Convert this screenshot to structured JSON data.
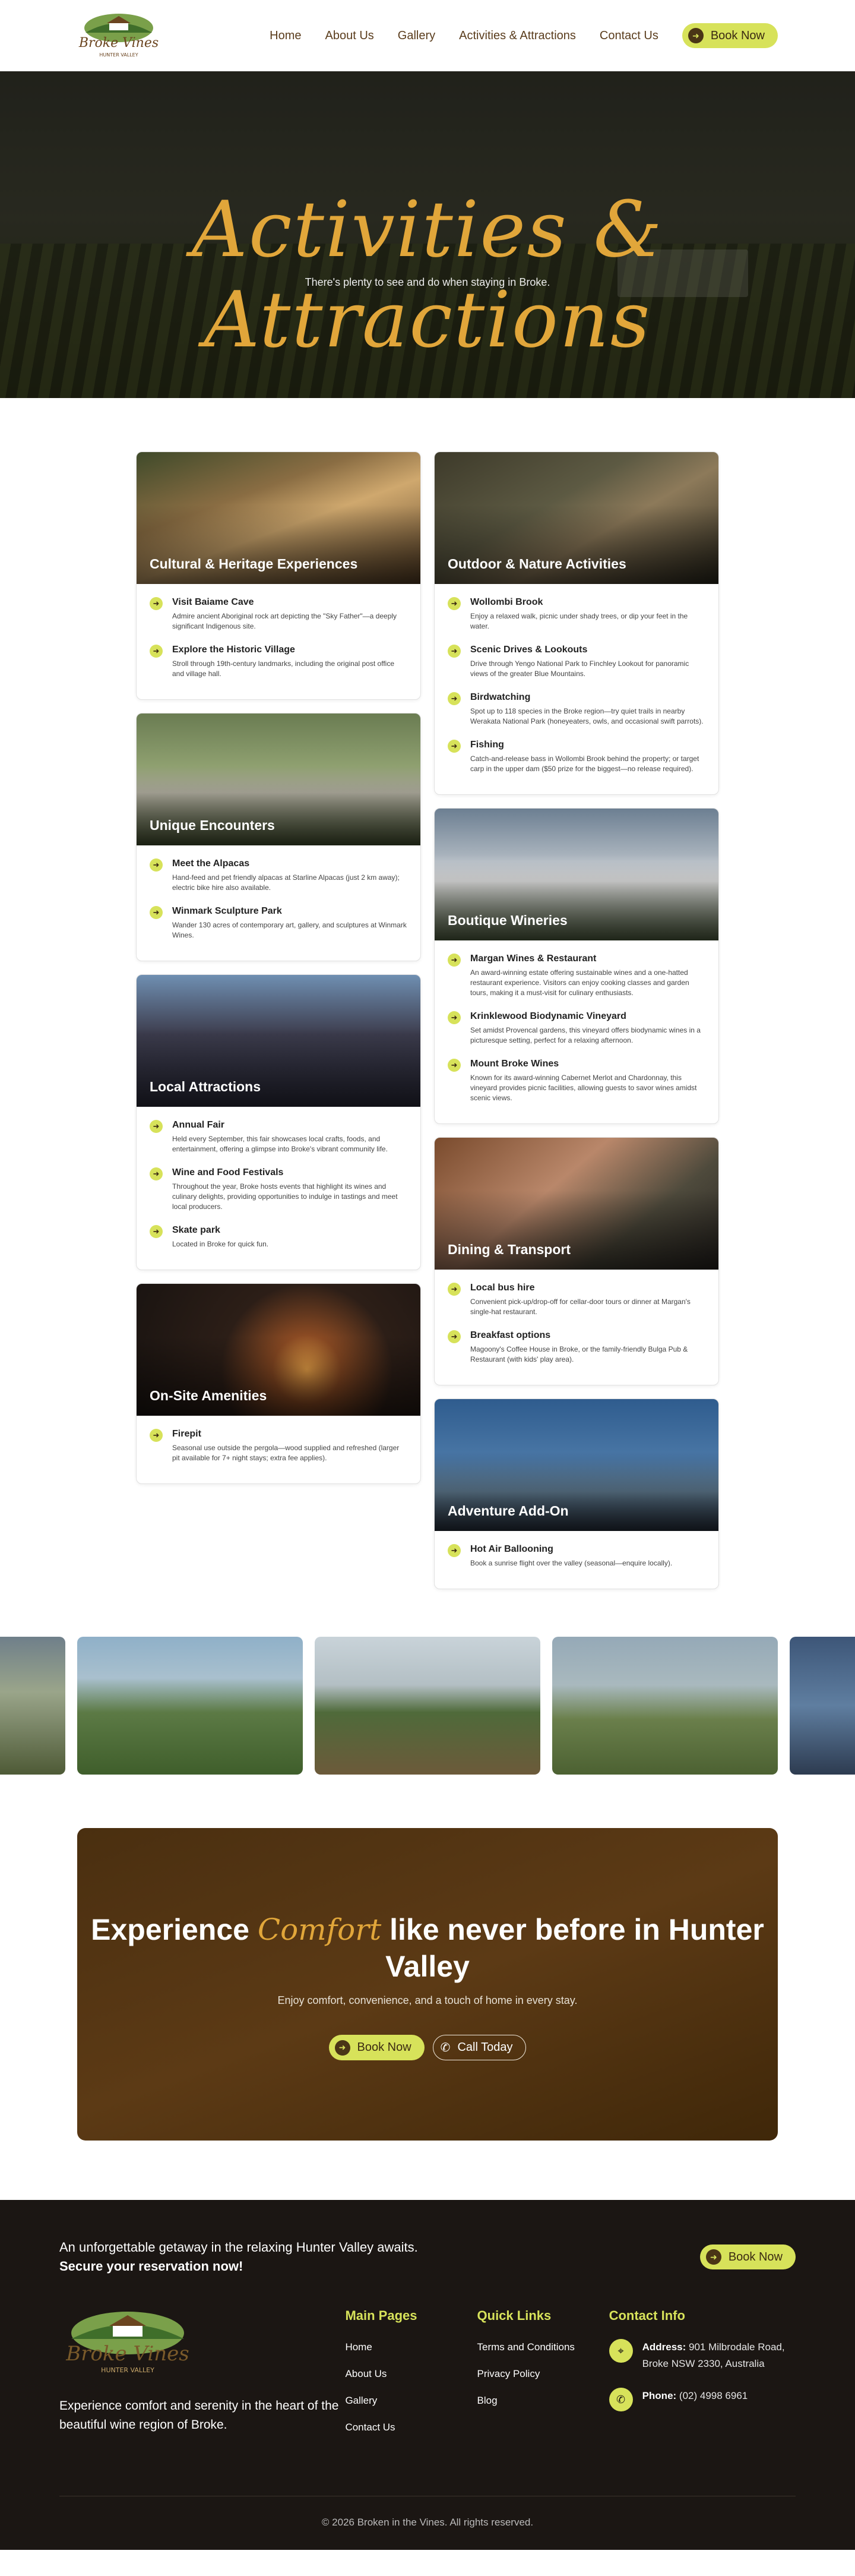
{
  "nav": {
    "logo_text": "Broke Vines",
    "logo_sub": "HUNTER VALLEY",
    "links": [
      "Home",
      "About Us",
      "Gallery",
      "Activities & Attractions",
      "Contact Us"
    ],
    "book_label": "Book Now"
  },
  "hero": {
    "title": "Activities & Attractions",
    "subtitle": "There's plenty to see and do when staying in Broke."
  },
  "cards": {
    "culture": {
      "title": "Cultural & Heritage Experiences",
      "items": [
        {
          "title": "Visit Baiame Cave",
          "desc": "Admire ancient Aboriginal rock art depicting the \"Sky Father\"—a deeply significant Indigenous site."
        },
        {
          "title": "Explore the Historic Village",
          "desc": "Stroll through 19th-century landmarks, including the original post office and village hall."
        }
      ]
    },
    "outdoor": {
      "title": "Outdoor & Nature Activities",
      "items": [
        {
          "title": "Wollombi Brook",
          "desc": "Enjoy a relaxed walk, picnic under shady trees, or dip your feet in the water."
        },
        {
          "title": "Scenic Drives & Lookouts",
          "desc": "Drive through Yengo National Park to Finchley Lookout for panoramic views of the greater Blue Mountains."
        },
        {
          "title": "Birdwatching",
          "desc": "Spot up to 118 species in the Broke region—try quiet trails in nearby Werakata National Park (honeyeaters, owls, and occasional swift parrots)."
        },
        {
          "title": "Fishing",
          "desc": "Catch-and-release bass in Wollombi Brook behind the property; or target carp in the upper dam ($50 prize for the biggest—no release required)."
        }
      ]
    },
    "encounters": {
      "title": "Unique Encounters",
      "items": [
        {
          "title": "Meet the Alpacas",
          "desc": "Hand-feed and pet friendly alpacas at Starline Alpacas (just 2 km away); electric bike hire also available."
        },
        {
          "title": "Winmark Sculpture Park",
          "desc": "Wander 130 acres of contemporary art, gallery, and sculptures at Winmark Wines."
        }
      ]
    },
    "wineries": {
      "title": "Boutique Wineries",
      "items": [
        {
          "title": "Margan Wines & Restaurant",
          "desc": "An award-winning estate offering sustainable wines and a one-hatted restaurant experience. Visitors can enjoy cooking classes and garden tours, making it a must-visit for culinary enthusiasts."
        },
        {
          "title": "Krinklewood Biodynamic Vineyard",
          "desc": "Set amidst Provencal gardens, this vineyard offers biodynamic wines in a picturesque setting, perfect for a relaxing afternoon."
        },
        {
          "title": "Mount Broke Wines",
          "desc": "Known for its award-winning Cabernet Merlot and Chardonnay, this vineyard provides picnic facilities, allowing guests to savor wines amidst scenic views."
        }
      ]
    },
    "local": {
      "title": "Local Attractions",
      "items": [
        {
          "title": "Annual Fair",
          "desc": "Held every September, this fair showcases local crafts, foods, and entertainment, offering a glimpse into Broke's vibrant community life."
        },
        {
          "title": "Wine and Food Festivals",
          "desc": "Throughout the year, Broke hosts events that highlight its wines and culinary delights, providing opportunities to indulge in tastings and meet local producers."
        },
        {
          "title": "Skate park",
          "desc": "Located in Broke for quick fun."
        }
      ]
    },
    "dining": {
      "title": "Dining & Transport",
      "items": [
        {
          "title": "Local bus hire",
          "desc": "Convenient pick-up/drop-off for cellar-door tours or dinner at Margan's single-hat restaurant."
        },
        {
          "title": "Breakfast options",
          "desc": "Magoony's Coffee House in Broke, or the family-friendly Bulga Pub & Restaurant (with kids' play area)."
        }
      ]
    },
    "onsite": {
      "title": "On-Site Amenities",
      "items": [
        {
          "title": "Firepit",
          "desc": "Seasonal use outside the pergola—wood supplied and refreshed (larger pit available for 7+ night stays; extra fee applies)."
        }
      ]
    },
    "balloon": {
      "title": "Adventure Add-On",
      "items": [
        {
          "title": "Hot Air Ballooning",
          "desc": "Book a sunrise flight over the valley (seasonal—enquire locally)."
        }
      ]
    }
  },
  "cta": {
    "title_before": "Experience ",
    "title_script": "Comfort",
    "title_after": " like never before in Hunter Valley",
    "subtitle": "Enjoy comfort, convenience, and a touch of home in every stay.",
    "book_label": "Book Now",
    "call_label": "Call Today"
  },
  "footer": {
    "tagline": "An unforgettable getaway in the relaxing Hunter Valley awaits.",
    "tagline_bold": "Secure your reservation now!",
    "book_label": "Book Now",
    "brand_text": "Experience comfort and serenity in the heart of the beautiful wine region of Broke.",
    "main_pages_title": "Main Pages",
    "main_pages": [
      "Home",
      "About Us",
      "Gallery",
      "Contact Us"
    ],
    "quick_links_title": "Quick Links",
    "quick_links": [
      "Terms and Conditions",
      "Privacy Policy",
      "Blog"
    ],
    "contact_title": "Contact Info",
    "address_label": "Address:",
    "address": "901 Milbrodale Road, Broke NSW 2330, Australia",
    "phone_label": "Phone:",
    "phone": "(02) 4998 6961",
    "copyright": "© 2026 Broken in the Vines. All rights reserved."
  },
  "colors": {
    "accent": "#d7e25a",
    "brand_brown": "#5a3c1c",
    "script_gold": "#e1a63a",
    "footer_bg": "#1b1613"
  },
  "icons": [
    "arrow-right-icon",
    "phone-icon",
    "location-icon"
  ]
}
